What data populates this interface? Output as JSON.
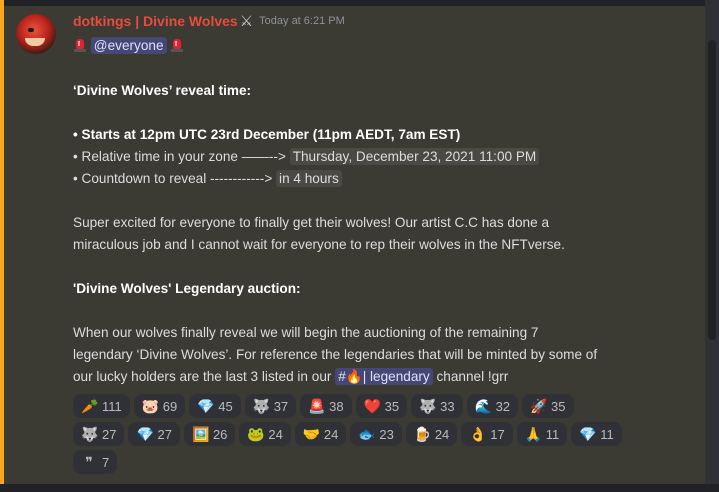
{
  "message": {
    "username": "dotkings | Divine Wolves",
    "timestamp": "Today at 6:21 PM",
    "mention": "@everyone",
    "reveal_heading": "‘Divine Wolves’ reveal time:",
    "starts_line": "• Starts at 12pm UTC 23rd December (11pm AEDT, 7am EST)",
    "relative_prefix": "• Relative time in your zone ——-->",
    "relative_value": "Thursday, December 23, 2021 11:00 PM",
    "countdown_prefix": "• Countdown to reveal ------------>",
    "countdown_value": "in 4 hours",
    "para1_line1": "Super excited for everyone to finally get their wolves! Our artist C.C has done a",
    "para1_line2": "miraculous job and I cannot wait for everyone to rep their wolves in the NFTverse.",
    "auction_heading": "'Divine Wolves' Legendary auction:",
    "para2_line1": "When our wolves finally reveal we will begin the auctioning of the remaining 7",
    "para2_line2": "legendary ‘Divine Wolves’. For reference the legendaries that will be minted by some of",
    "para2_line3_prefix": "our lucky holders are the last 3 listed in our",
    "channel": "#🔥| legendary",
    "para2_line3_suffix": "channel !grr"
  },
  "reactions": [
    [
      {
        "emoji": "🥕",
        "icon": "carrot-icon",
        "count": "111"
      },
      {
        "emoji": "🐷",
        "icon": "pig-icon",
        "count": "69"
      },
      {
        "emoji": "💎",
        "icon": "green-gem-icon",
        "count": "45"
      },
      {
        "emoji": "🐺",
        "icon": "wolf-icon",
        "count": "37"
      },
      {
        "emoji": "🚨",
        "icon": "siren-icon",
        "count": "38"
      },
      {
        "emoji": "❤️",
        "icon": "heart-icon",
        "count": "35"
      },
      {
        "emoji": "🐺",
        "icon": "wolf-dark-icon",
        "count": "33"
      },
      {
        "emoji": "🌊",
        "icon": "wave-icon",
        "count": "32"
      },
      {
        "emoji": "🚀",
        "icon": "rocket-icon",
        "count": "35"
      }
    ],
    [
      {
        "emoji": "🐺",
        "icon": "wolf-blue-icon",
        "count": "27"
      },
      {
        "emoji": "💎",
        "icon": "diamond-small-icon",
        "count": "27"
      },
      {
        "emoji": "🖼️",
        "icon": "frame-icon",
        "count": "26"
      },
      {
        "emoji": "🐸",
        "icon": "frog-icon",
        "count": "24"
      },
      {
        "emoji": "🤝",
        "icon": "handshake-icon",
        "count": "24"
      },
      {
        "emoji": "🐟",
        "icon": "fish-icon",
        "count": "23"
      },
      {
        "emoji": "🍺",
        "icon": "beer-icon",
        "count": "24"
      },
      {
        "emoji": "👌",
        "icon": "ok-hand-icon",
        "count": "17"
      },
      {
        "emoji": "🙏",
        "icon": "pray-icon",
        "count": "11"
      },
      {
        "emoji": "💎",
        "icon": "diamond-icon",
        "count": "11"
      }
    ],
    [
      {
        "emoji": "❞",
        "icon": "quote-icon",
        "count": "7"
      }
    ]
  ]
}
